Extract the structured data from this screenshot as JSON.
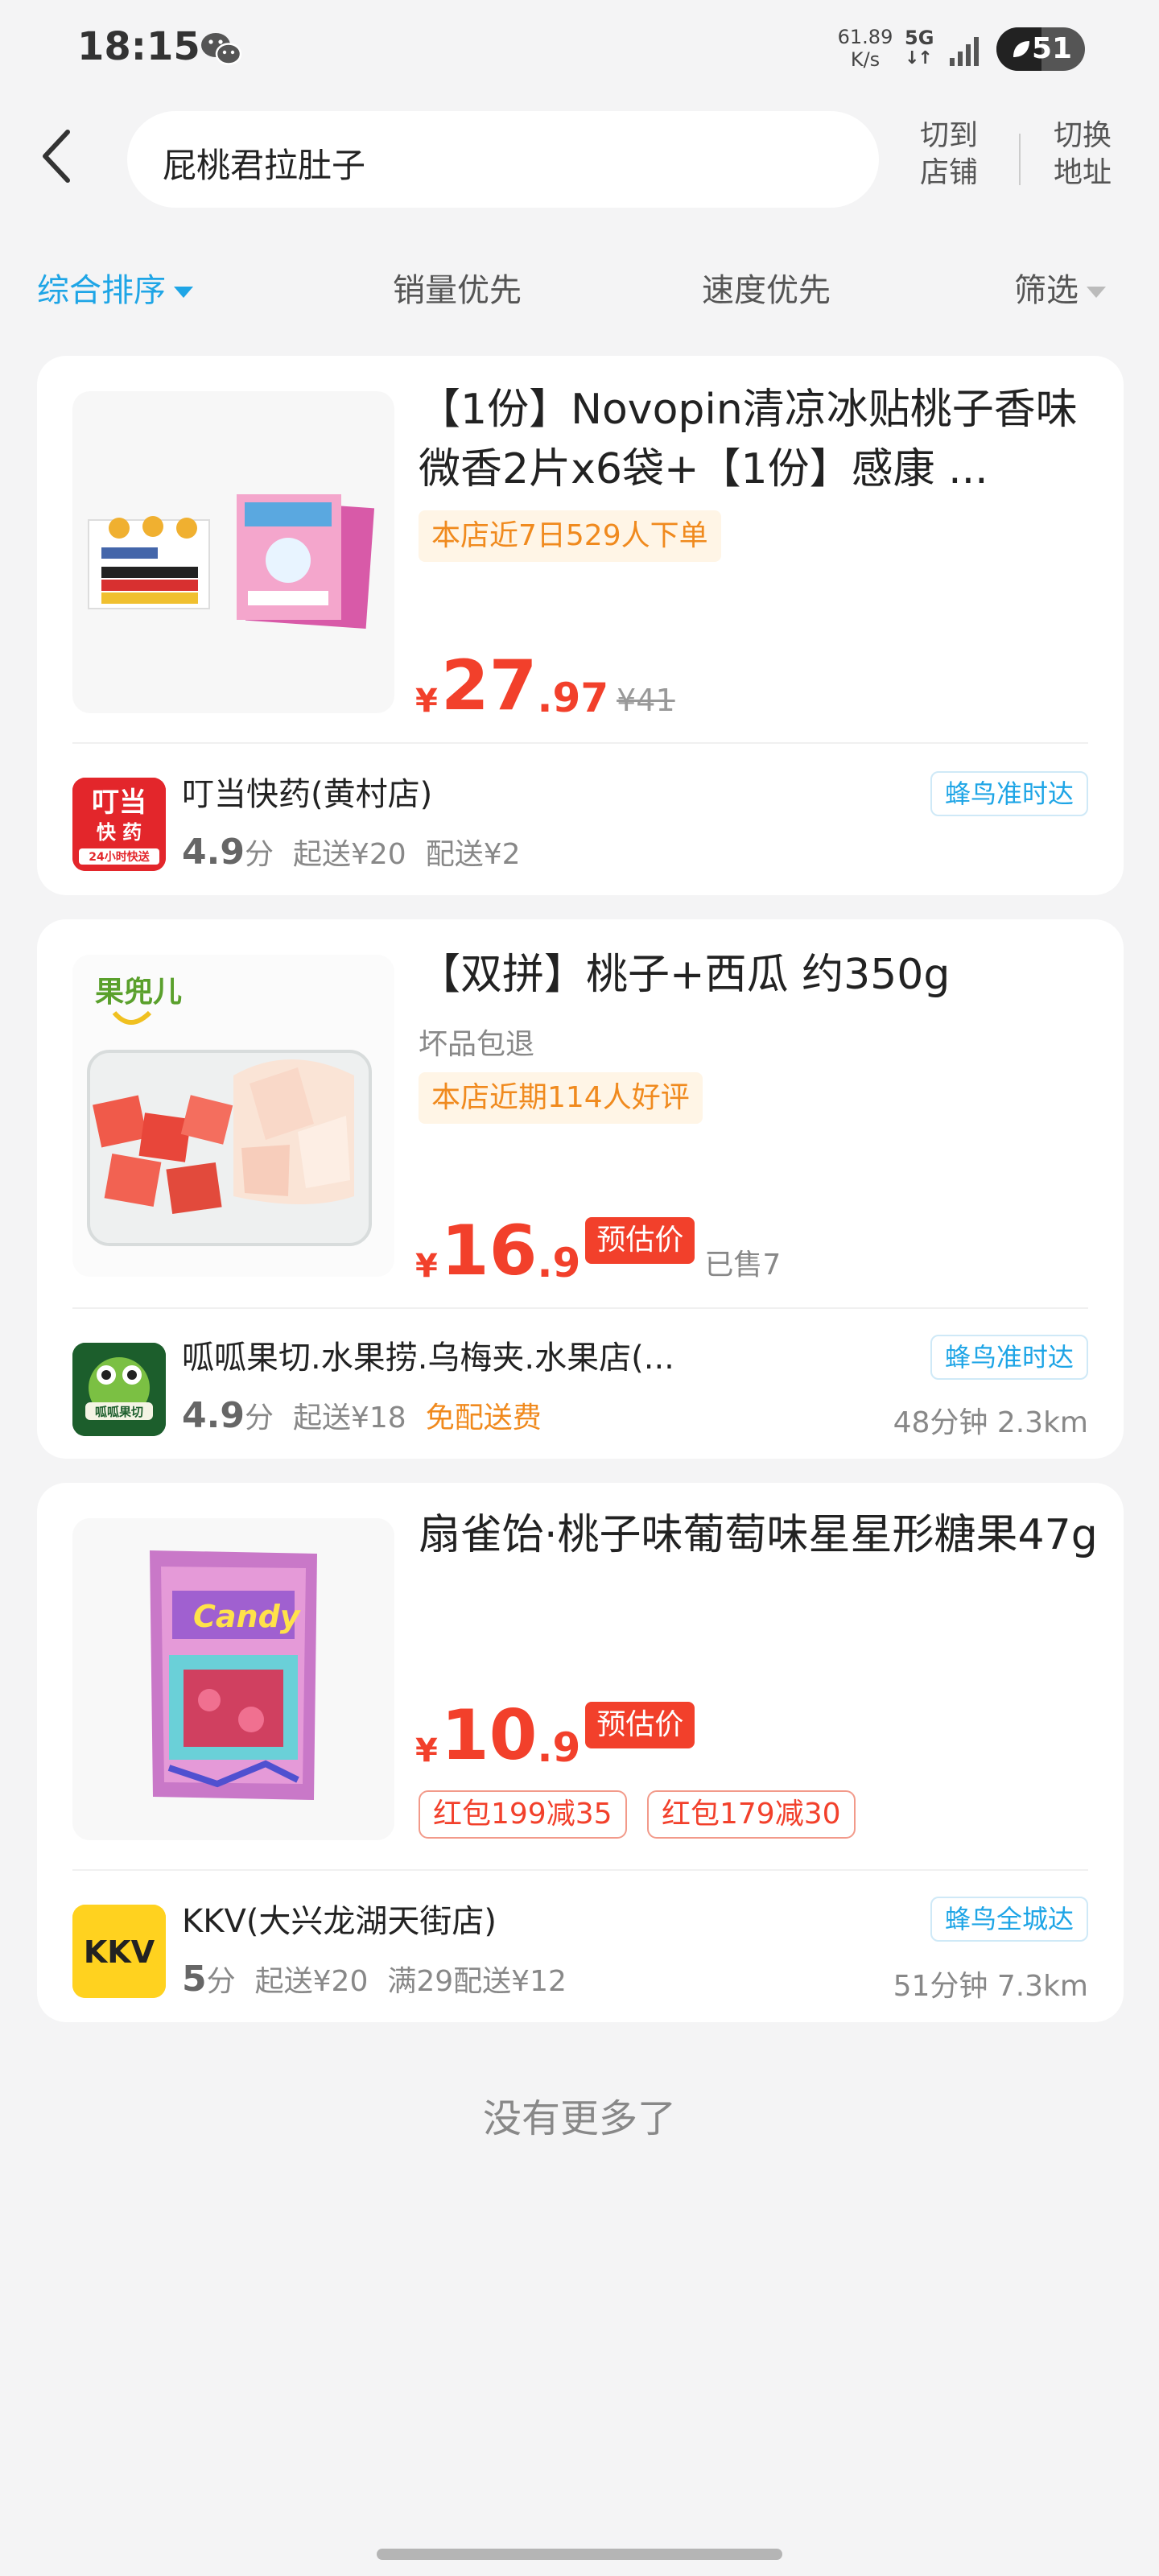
{
  "status_bar": {
    "time": "18:15",
    "net_speed_value": "61.89",
    "net_speed_unit": "K/s",
    "network": "5G",
    "battery": "51",
    "battery_level": 0.51
  },
  "header": {
    "search_query": "屁桃君拉肚子",
    "switch_store_line1": "切到",
    "switch_store_line2": "店铺",
    "switch_address_line1": "切换",
    "switch_address_line2": "地址"
  },
  "sort_bar": {
    "items": [
      "综合排序",
      "销量优先",
      "速度优先",
      "筛选"
    ],
    "active_index": 0
  },
  "products": [
    {
      "title": "【1份】Novopin清凉冰贴桃子香味微香2片x6袋+【1份】感康 ...",
      "tag": "本店近7日529人下单",
      "currency": "¥",
      "price_int": "27",
      "price_dec": ".97",
      "original_price": "¥41",
      "store": {
        "name": "叮当快药(黄村店)",
        "rating": "4.9",
        "rating_unit": "分",
        "min_order": "起送¥20",
        "delivery_fee": "配送¥2",
        "delivery_badge": "蜂鸟准时达",
        "logo_text_1": "叮当",
        "logo_text_2": "快 药",
        "logo_text_3": "24小时快送"
      }
    },
    {
      "title": "【双拼】桃子+西瓜 约350g",
      "subtitle": "坏品包退",
      "tag": "本店近期114人好评",
      "currency": "¥",
      "price_int": "16",
      "price_dec": ".9",
      "estimate_badge": "预估价",
      "sold": "已售7",
      "image_brand": "果兜儿",
      "store": {
        "name": "呱呱果切.水果捞.乌梅夹.水果店(...",
        "rating": "4.9",
        "rating_unit": "分",
        "min_order": "起送¥18",
        "delivery_fee": "免配送费",
        "delivery_badge": "蜂鸟准时达",
        "eta_distance": "48分钟 2.3km",
        "logo_text": "呱呱果切"
      }
    },
    {
      "title": "扇雀饴·桃子味葡萄味星星形糖果47g",
      "currency": "¥",
      "price_int": "10",
      "price_dec": ".9",
      "estimate_badge": "预估价",
      "coupons": [
        "红包199减35",
        "红包179减30"
      ],
      "image_text": "Candy",
      "store": {
        "name": "KKV(大兴龙湖天街店)",
        "rating": "5",
        "rating_unit": "分",
        "min_order": "起送¥20",
        "delivery_fee": "满29配送¥12",
        "delivery_badge": "蜂鸟全城达",
        "eta_distance": "51分钟 7.3km",
        "logo_text": "KKV"
      }
    }
  ],
  "footer": {
    "no_more": "没有更多了"
  },
  "colors": {
    "accent_blue": "#1ea5e6",
    "price_red": "#f2402b",
    "tag_orange": "#f08a1e",
    "background": "#f4f4f5"
  },
  "icons": [
    "wechat-icon",
    "signal-icon",
    "battery-icon",
    "back-arrow-icon",
    "dropdown-triangle-icon"
  ]
}
